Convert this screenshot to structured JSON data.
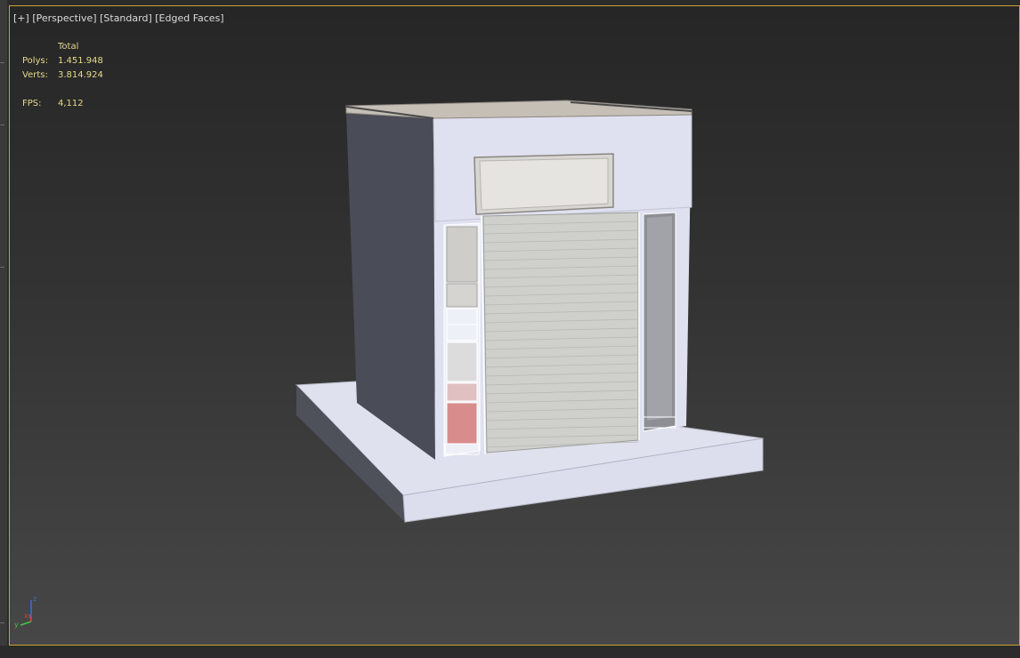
{
  "viewport": {
    "label_parts": [
      "[+]",
      "[Perspective]",
      "[Standard]",
      "[Edged Faces]"
    ]
  },
  "stats": {
    "header": "Total",
    "polys_label": "Polys:",
    "polys_value": "1.451.948",
    "verts_label": "Verts:",
    "verts_value": "3.814.924",
    "fps_label": "FPS:",
    "fps_value": "4,112"
  },
  "axis": {
    "z": "z",
    "x": "x",
    "y": "y"
  },
  "colors": {
    "viewport_border": "#c8a233",
    "stats_text": "#e6d98a",
    "model_light": "#dfe1f0",
    "model_dark": "#4a4c57",
    "roof": "#c5bfb6"
  }
}
